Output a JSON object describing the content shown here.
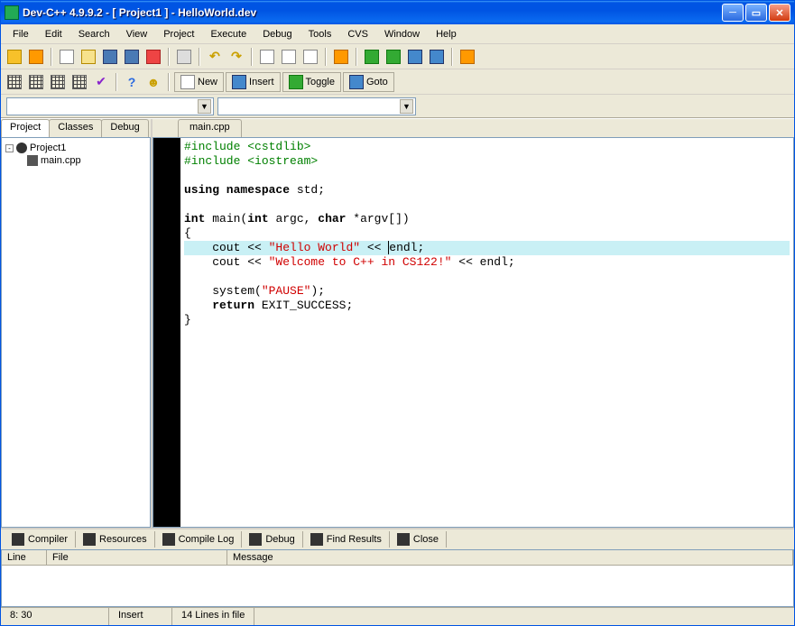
{
  "title": "Dev-C++ 4.9.9.2  -  [ Project1 ] - HelloWorld.dev",
  "menu": [
    "File",
    "Edit",
    "Search",
    "View",
    "Project",
    "Execute",
    "Debug",
    "Tools",
    "CVS",
    "Window",
    "Help"
  ],
  "toolbar2": {
    "new": "New",
    "insert": "Insert",
    "toggle": "Toggle",
    "goto": "Goto"
  },
  "left_tabs": [
    "Project",
    "Classes",
    "Debug"
  ],
  "tree": {
    "root": "Project1",
    "child": "main.cpp"
  },
  "file_tab": "main.cpp",
  "code": {
    "l1a": "#include ",
    "l1b": "<cstdlib>",
    "l2a": "#include ",
    "l2b": "<iostream>",
    "l3": "",
    "l4a": "using namespace ",
    "l4b": "std;",
    "l5": "",
    "l6a": "int ",
    "l6b": "main(",
    "l6c": "int ",
    "l6d": "argc, ",
    "l6e": "char ",
    "l6f": "*argv[])",
    "l7": "{",
    "l8a": "    cout << ",
    "l8b": "\"Hello World\"",
    "l8c": " << ",
    "l8d": "endl;",
    "l9a": "    cout << ",
    "l9b": "\"Welcome to C++ in CS122!\"",
    "l9c": " << endl;",
    "l10": "    ",
    "l11a": "    system(",
    "l11b": "\"PAUSE\"",
    "l11c": ");",
    "l12a": "    return ",
    "l12b": "EXIT_SUCCESS;",
    "l13": "}"
  },
  "bottom_tabs": [
    "Compiler",
    "Resources",
    "Compile Log",
    "Debug",
    "Find Results",
    "Close"
  ],
  "msg_headers": {
    "line": "Line",
    "file": "File",
    "message": "Message"
  },
  "status": {
    "pos": "8: 30",
    "mode": "Insert",
    "lines": "14 Lines in file"
  }
}
